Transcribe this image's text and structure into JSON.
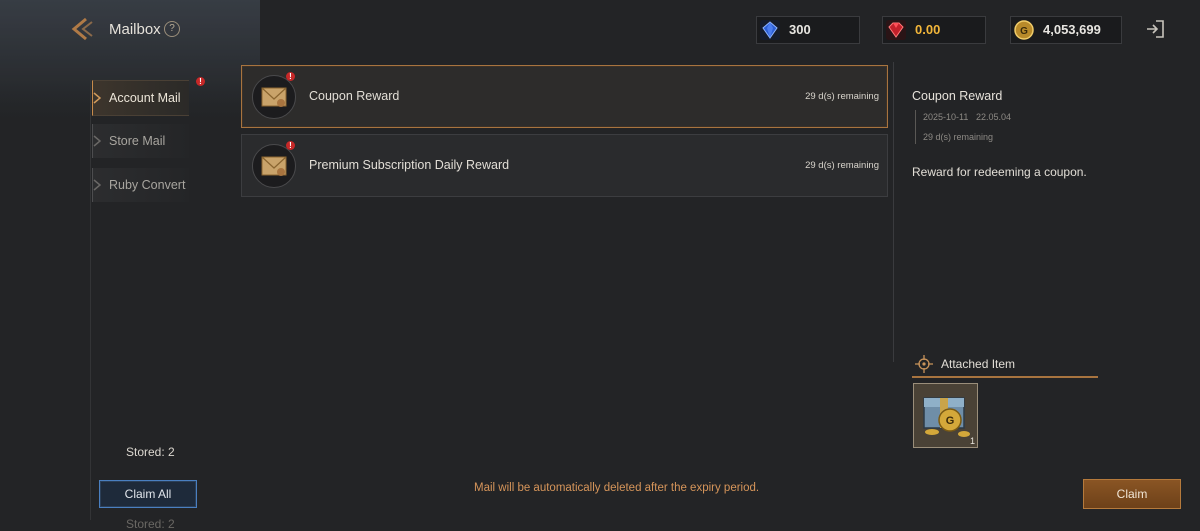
{
  "header": {
    "title": "Mailbox",
    "help_glyph": "?"
  },
  "currencies": {
    "sapphire": {
      "icon": "blue-gem-icon",
      "value": "300"
    },
    "ruby": {
      "icon": "red-gem-icon",
      "value": "0.00",
      "color": "#f2b63a"
    },
    "gold": {
      "icon": "gold-coin-icon",
      "value": "4,053,699"
    }
  },
  "sidebar": {
    "items": [
      {
        "label": "Account Mail",
        "active": true,
        "badge": "!"
      },
      {
        "label": "Store Mail",
        "active": false
      },
      {
        "label": "Ruby Convert",
        "active": false
      }
    ],
    "stored": "Stored: 2",
    "claim_all": "Claim All",
    "stored_ghost": "Stored: 2"
  },
  "mails": [
    {
      "subject": "Coupon Reward",
      "remaining": "29 d(s) remaining",
      "badge": "!",
      "selected": true
    },
    {
      "subject": "Premium Subscription Daily Reward",
      "remaining": "29 d(s) remaining",
      "badge": "!",
      "selected": false
    }
  ],
  "footer": {
    "note": "Mail will be automatically deleted after the expiry period."
  },
  "detail": {
    "title": "Coupon Reward",
    "date": "2025-10-11",
    "time": "22.05.04",
    "remaining": "29 d(s) remaining",
    "body": "Reward for redeeming a coupon.",
    "attached_label": "Attached Item",
    "item": {
      "icon": "gold-chest-icon",
      "quantity": "1"
    },
    "claim": "Claim"
  },
  "colors": {
    "accent": "#a8743f",
    "claim_all_border": "#4a7fc0",
    "note": "#d6955a",
    "badge": "#c62828"
  }
}
